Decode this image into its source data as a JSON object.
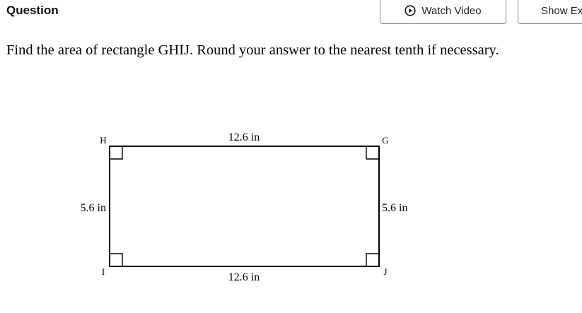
{
  "header": {
    "title": "Question",
    "watch_video_label": "Watch Video",
    "show_examples_label": "Show Ex"
  },
  "question": {
    "text": "Find the area of rectangle GHIJ. Round your answer to the nearest tenth if necessary."
  },
  "figure": {
    "vertices": {
      "top_left": "H",
      "top_right": "G",
      "bottom_left": "I",
      "bottom_right": "J"
    },
    "labels": {
      "top": "12.6 in",
      "bottom": "12.6 in",
      "left": "5.6 in",
      "right": "5.6 in"
    }
  },
  "colors": {
    "button_border": "#8a8a8a",
    "text": "#000000"
  },
  "icons": {
    "watch_video": "play-circle-icon"
  }
}
